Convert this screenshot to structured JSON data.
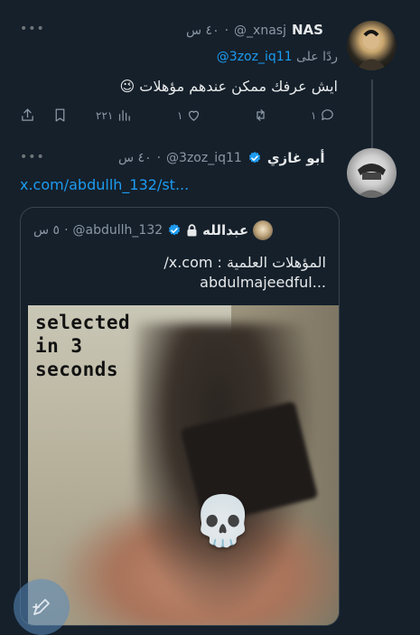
{
  "tweet1": {
    "name": "NAS",
    "handle": "@_xnasj",
    "time": "٤٠ س",
    "reply_to_label": "ردًا على",
    "reply_to_handle": "@3zoz_iq11",
    "text": "ايش عرفك ممكن عندهم مؤهلات 😉",
    "actions": {
      "replies": "١",
      "retweets": "",
      "likes": "١",
      "views": "٢٢١"
    }
  },
  "tweet2": {
    "name": "أبو غازي",
    "handle": "@3zoz_iq11",
    "time": "٤٠ س",
    "link": "x.com/abdullh_132/st..."
  },
  "quote": {
    "name": "عبدالله",
    "handle": "@abdullh_132",
    "time": "٥ س",
    "line1": "المؤهلات العلمية : x.com/",
    "line2": "abdulmajeedful...",
    "media_text": "selected\nin 3\nseconds",
    "media_emoji": "💀"
  },
  "icons": [
    "more-icon",
    "reply-icon",
    "retweet-icon",
    "like-icon",
    "views-icon",
    "bookmark-icon",
    "share-icon",
    "verified-icon",
    "lock-icon",
    "compose-icon"
  ],
  "colors": {
    "background": "#15202b",
    "link": "#1d9bf0",
    "muted": "#8b98a5",
    "verified": "#1d9bf0"
  }
}
